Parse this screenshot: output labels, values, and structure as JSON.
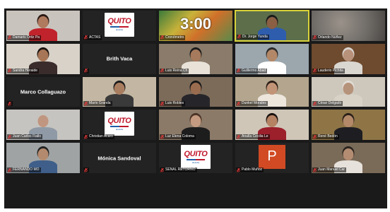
{
  "colors": {
    "tile_bg": "#232323",
    "mic_muted": "#e03a3a",
    "active_border": "#d8d23a",
    "logo_red": "#c0172b",
    "logo_blue": "#1e5ca8",
    "powerpoint": "#d14a24"
  },
  "tiles": [
    {
      "name": "Damaris Ortiz Pa",
      "kind": "video",
      "bg": "#c9c3bd",
      "skin": "#b07a5e",
      "shirt": "#c0232b",
      "hair": "#2b1a14"
    },
    {
      "name": "ACTAS",
      "kind": "logo"
    },
    {
      "name": "Cronómetro",
      "kind": "timer",
      "timer": "3:00"
    },
    {
      "name": "Dr. Jorge Yunda",
      "kind": "video",
      "bg": "#5c6e4a",
      "skin": "#8a5f44",
      "shirt": "#2f5dad",
      "hair": "#1a1a1a",
      "active": true
    },
    {
      "name": "Orlando Núñez",
      "kind": "blur",
      "bg": "#6d6a66"
    },
    {
      "name": "Sandra Heraide",
      "kind": "video",
      "bg": "#d8d2c8",
      "skin": "#a77656",
      "shirt": "#3a2c2a",
      "hair": "#1a120e"
    },
    {
      "name": "Brith Vaca",
      "kind": "name"
    },
    {
      "name": "Luis Reina Ch",
      "kind": "video",
      "bg": "#8a7b6a",
      "skin": "#a67a5c",
      "shirt": "#e8e2d8",
      "hair": "#1a1a1a"
    },
    {
      "name": "Guillermo Abad",
      "kind": "video",
      "bg": "#9ba6ad",
      "skin": "#b38868",
      "shirt": "#ffffff",
      "hair": "#2a2a2a"
    },
    {
      "name": "Lauderio Pichita",
      "kind": "video",
      "bg": "#6e4a2e",
      "skin": "#b8917a",
      "shirt": "#dad6d0",
      "hair": "#d9d4cf"
    },
    {
      "name": "Marco Collaguazo",
      "kind": "name"
    },
    {
      "name": "Mario Granda",
      "kind": "video",
      "bg": "#c3b7a3",
      "skin": "#a97d60",
      "shirt": "#3a3a3a",
      "hair": "#1a1a1a"
    },
    {
      "name": "Luis Robles",
      "kind": "video",
      "bg": "#7d6b5a",
      "skin": "#996c4f",
      "shirt": "#26262a",
      "hair": "#161616"
    },
    {
      "name": "Dunkel Morales",
      "kind": "video",
      "bg": "#b4a68e",
      "skin": "#c29477",
      "shirt": "#ece6dd",
      "hair": "#2a1d16"
    },
    {
      "name": "César Delgado",
      "kind": "video",
      "bg": "#cdc7bc",
      "skin": "#b5927a",
      "shirt": "#d7d1c6",
      "hair": "#e2ddd6"
    },
    {
      "name": "Juan Carlos Fiallo",
      "kind": "video",
      "bg": "#c6c4c0",
      "skin": "#c09680",
      "shirt": "#8f9aa6",
      "hair": "#c7c3bd"
    },
    {
      "name": "Christian Acaro",
      "kind": "logo"
    },
    {
      "name": "Luz Elena Coloma",
      "kind": "video",
      "bg": "#8c7a68",
      "skin": "#c49a80",
      "shirt": "#1d1d1d",
      "hair": "#4a3426"
    },
    {
      "name": "Analía Cecilia Le",
      "kind": "video",
      "bg": "#cfc6b8",
      "skin": "#b58264",
      "shirt": "#9c1f2c",
      "hair": "#1b120e"
    },
    {
      "name": "René Bedón",
      "kind": "video",
      "bg": "#8f7546",
      "skin": "#b3896a",
      "shirt": "#1e1e22",
      "hair": "#2a1f18"
    },
    {
      "name": "FERNANDO MO",
      "kind": "video",
      "bg": "#9fa3a4",
      "skin": "#b48a6e",
      "shirt": "#3f5f8a",
      "hair": "#222222"
    },
    {
      "name": "Mónica Sandoval",
      "kind": "name"
    },
    {
      "name": "SEÑAL RETORNO",
      "kind": "logo"
    },
    {
      "name": "Pablo Muñoz",
      "kind": "ppt",
      "ppt_letter": "P"
    },
    {
      "name": "Juan Manuel Car",
      "kind": "video",
      "bg": "#7a6a58",
      "skin": "#b38c72",
      "shirt": "#e6e1da",
      "hair": "#2a241e"
    }
  ],
  "logo": {
    "text": "QUITO",
    "sub": "alcaldía"
  },
  "row_count_note": "grid 5 columns"
}
